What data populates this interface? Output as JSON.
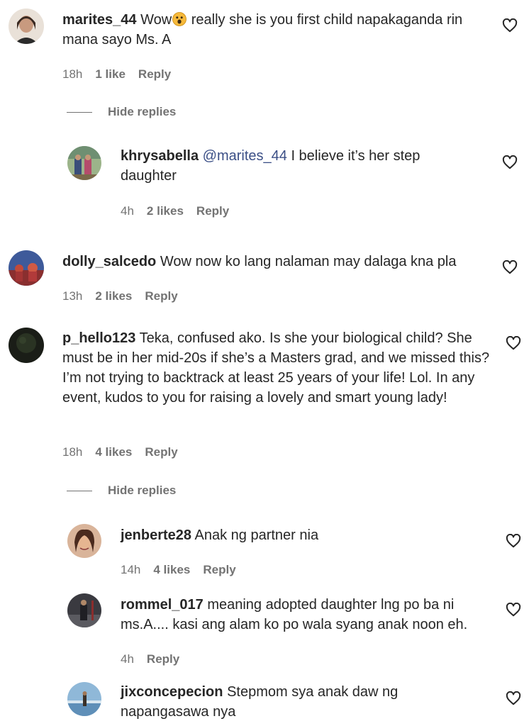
{
  "comments": [
    {
      "username": "marites_44",
      "text_before": "Wow",
      "emoji": "astonished-face-emoji",
      "text_after": " really she is you first child napakaganda rin mana sayo Ms. A",
      "time": "18h",
      "likes": "1 like",
      "reply": "Reply",
      "hide_replies": "Hide replies",
      "replies": [
        {
          "username": "khrysabella",
          "mention": "@marites_44",
          "text": " I believe it’s her step daughter",
          "time": "4h",
          "likes": "2 likes",
          "reply": "Reply"
        }
      ]
    },
    {
      "username": "dolly_salcedo",
      "text": "Wow now ko lang nalaman may dalaga kna pla",
      "time": "13h",
      "likes": "2 likes",
      "reply": "Reply"
    },
    {
      "username": "p_hello123",
      "text": "Teka, confused ako. Is she your biological child? She must be in her mid-20s if she’s a Masters grad, and we missed this? I’m not trying to backtrack at least 25 years of your life! Lol. In any event, kudos to you for raising a lovely and smart young lady!",
      "time": "18h",
      "likes": "4 likes",
      "reply": "Reply",
      "hide_replies": "Hide replies",
      "replies": [
        {
          "username": "jenberte28",
          "text": "Anak ng partner nia",
          "time": "14h",
          "likes": "4 likes",
          "reply": "Reply"
        },
        {
          "username": "rommel_017",
          "text": "meaning adopted daughter lng po ba ni ms.A.... kasi ang alam ko po wala syang anak noon eh.",
          "time": "4h",
          "reply": "Reply"
        },
        {
          "username": "jixconcepecion",
          "text": "Stepmom sya anak daw ng napangasawa nya"
        }
      ]
    }
  ],
  "icons": {
    "like": "heart-outline-icon"
  },
  "colors": {
    "text": "#262626",
    "meta": "#737373",
    "mention": "#3b4f86"
  }
}
